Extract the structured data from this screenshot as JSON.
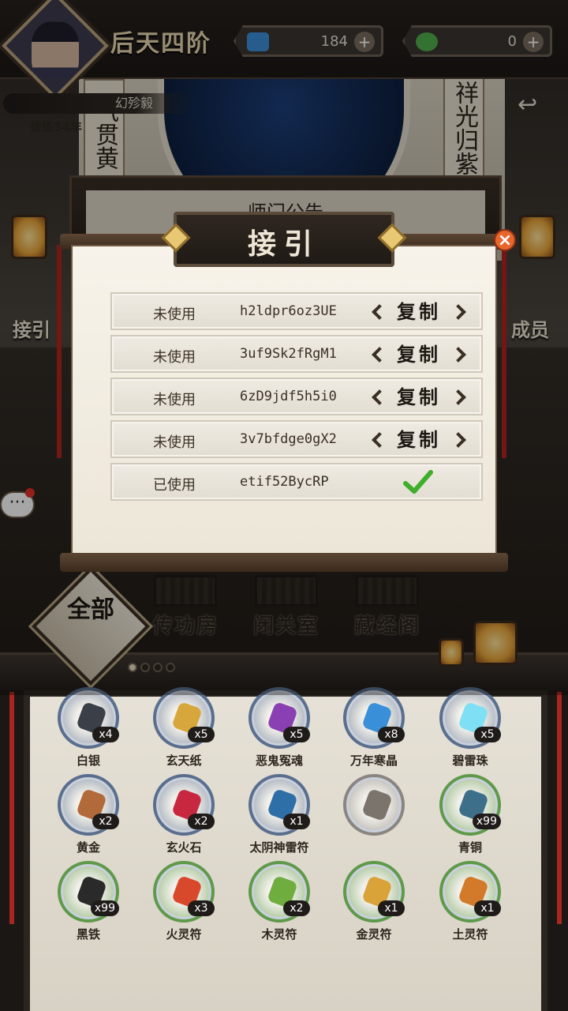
{
  "hud": {
    "realm": "后天四阶",
    "currencies": [
      {
        "icon": "blue-crystal-icon",
        "value": "184"
      },
      {
        "icon": "jade-coin-icon",
        "value": "0"
      }
    ],
    "player_name": "幻殄毅",
    "cultivation": "修炼54年"
  },
  "scene": {
    "banner_left": "气贯黄",
    "banner_right": "祥光归紫",
    "notice_title": "师门公告",
    "side_left": "接引",
    "side_right": "成员"
  },
  "modal": {
    "title": "接引",
    "rows": [
      {
        "status": "未使用",
        "code": "h2ldpr6oz3UE",
        "action": "复制",
        "used": false
      },
      {
        "status": "未使用",
        "code": "3uf9Sk2fRgM1",
        "action": "复制",
        "used": false
      },
      {
        "status": "未使用",
        "code": "6zD9jdf5h5i0",
        "action": "复制",
        "used": false
      },
      {
        "status": "未使用",
        "code": "3v7bfdge0gX2",
        "action": "复制",
        "used": false
      },
      {
        "status": "已使用",
        "code": "etif52BycRP",
        "action": "",
        "used": true
      }
    ]
  },
  "buildings": [
    "传功房",
    "闭关室",
    "藏经阁"
  ],
  "filter": {
    "label": "全部",
    "pages": 4,
    "current": 1
  },
  "inventory": [
    {
      "name": "白银",
      "qty": "x4",
      "frame": "#5a6f8e",
      "gem": "#3b3f48"
    },
    {
      "name": "玄天纸",
      "qty": "x5",
      "frame": "#5a6f8e",
      "gem": "#d7a73b"
    },
    {
      "name": "恶鬼冤魂",
      "qty": "x5",
      "frame": "#5a6f8e",
      "gem": "#8a3fb2"
    },
    {
      "name": "万年寒晶",
      "qty": "x8",
      "frame": "#5a6f8e",
      "gem": "#3a8fd9"
    },
    {
      "name": "碧雷珠",
      "qty": "x5",
      "frame": "#5a6f8e",
      "gem": "#7fe0f5"
    },
    {
      "name": "黄金",
      "qty": "x2",
      "frame": "#5a6f8e",
      "gem": "#b36a3a"
    },
    {
      "name": "玄火石",
      "qty": "x2",
      "frame": "#5a6f8e",
      "gem": "#c7283f"
    },
    {
      "name": "太阴神雷符",
      "qty": "x1",
      "frame": "#5a6f8e",
      "gem": "#2f6fa8"
    },
    {
      "name": "",
      "qty": "",
      "frame": "#8a8580",
      "gem": "#7b746c"
    },
    {
      "name": "青铜",
      "qty": "x99",
      "frame": "#5f9a4a",
      "gem": "#3e6f8a"
    },
    {
      "name": "黑铁",
      "qty": "x99",
      "frame": "#5f9a4a",
      "gem": "#2a2a2a"
    },
    {
      "name": "火灵符",
      "qty": "x3",
      "frame": "#5f9a4a",
      "gem": "#d8492c"
    },
    {
      "name": "木灵符",
      "qty": "x2",
      "frame": "#5f9a4a",
      "gem": "#6fae3e"
    },
    {
      "name": "金灵符",
      "qty": "x1",
      "frame": "#5f9a4a",
      "gem": "#d9a33a"
    },
    {
      "name": "土灵符",
      "qty": "x1",
      "frame": "#5f9a4a",
      "gem": "#d27a2a"
    }
  ]
}
